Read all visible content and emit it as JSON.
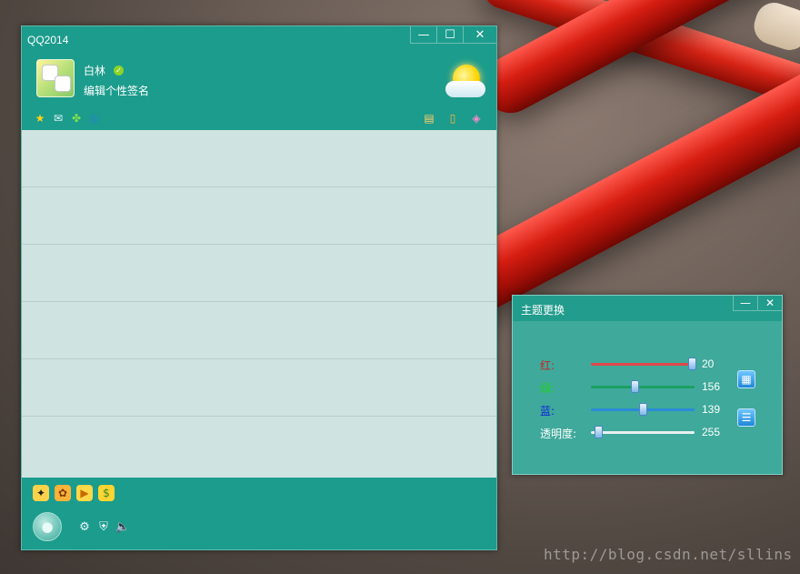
{
  "qq_window": {
    "title": "QQ2014",
    "title_buttons": {
      "minimize": "—",
      "maximize": "☐",
      "close": "✕"
    },
    "profile": {
      "nickname": "白林",
      "signature": "编辑个性签名"
    },
    "toolbar_left_icons": [
      "star-icon",
      "mail-icon",
      "clover-icon",
      "browser-icon"
    ],
    "toolbar_right_icons": [
      "message-box-icon",
      "phone-icon",
      "color-palette-icon"
    ],
    "contact_rows": 6,
    "bottom_icons": [
      "penguin-icon",
      "pet-icon",
      "video-icon",
      "coin-icon"
    ],
    "bottom_tools": [
      "settings-icon",
      "shield-icon",
      "speaker-icon"
    ]
  },
  "theme_window": {
    "title": "主题更换",
    "title_buttons": {
      "minimize": "—",
      "close": "✕"
    },
    "sliders": [
      {
        "label": "红:",
        "value": "20",
        "fraction": 0.97,
        "label_color": "#d02020",
        "track_color": "#e04848"
      },
      {
        "label": "绿:",
        "value": "156",
        "fraction": 0.42,
        "label_color": "#20d020",
        "track_color": "#1aa062"
      },
      {
        "label": "蓝:",
        "value": "139",
        "fraction": 0.5,
        "label_color": "#1024d8",
        "track_color": "#2a8ad8"
      },
      {
        "label": "透明度:",
        "value": "255",
        "fraction": 0.07,
        "label_color": "#ffffff",
        "track_color": "#e8f0f0"
      }
    ],
    "side_buttons": [
      "grid-icon",
      "list-icon"
    ]
  },
  "watermark": "http://blog.csdn.net/sllins"
}
